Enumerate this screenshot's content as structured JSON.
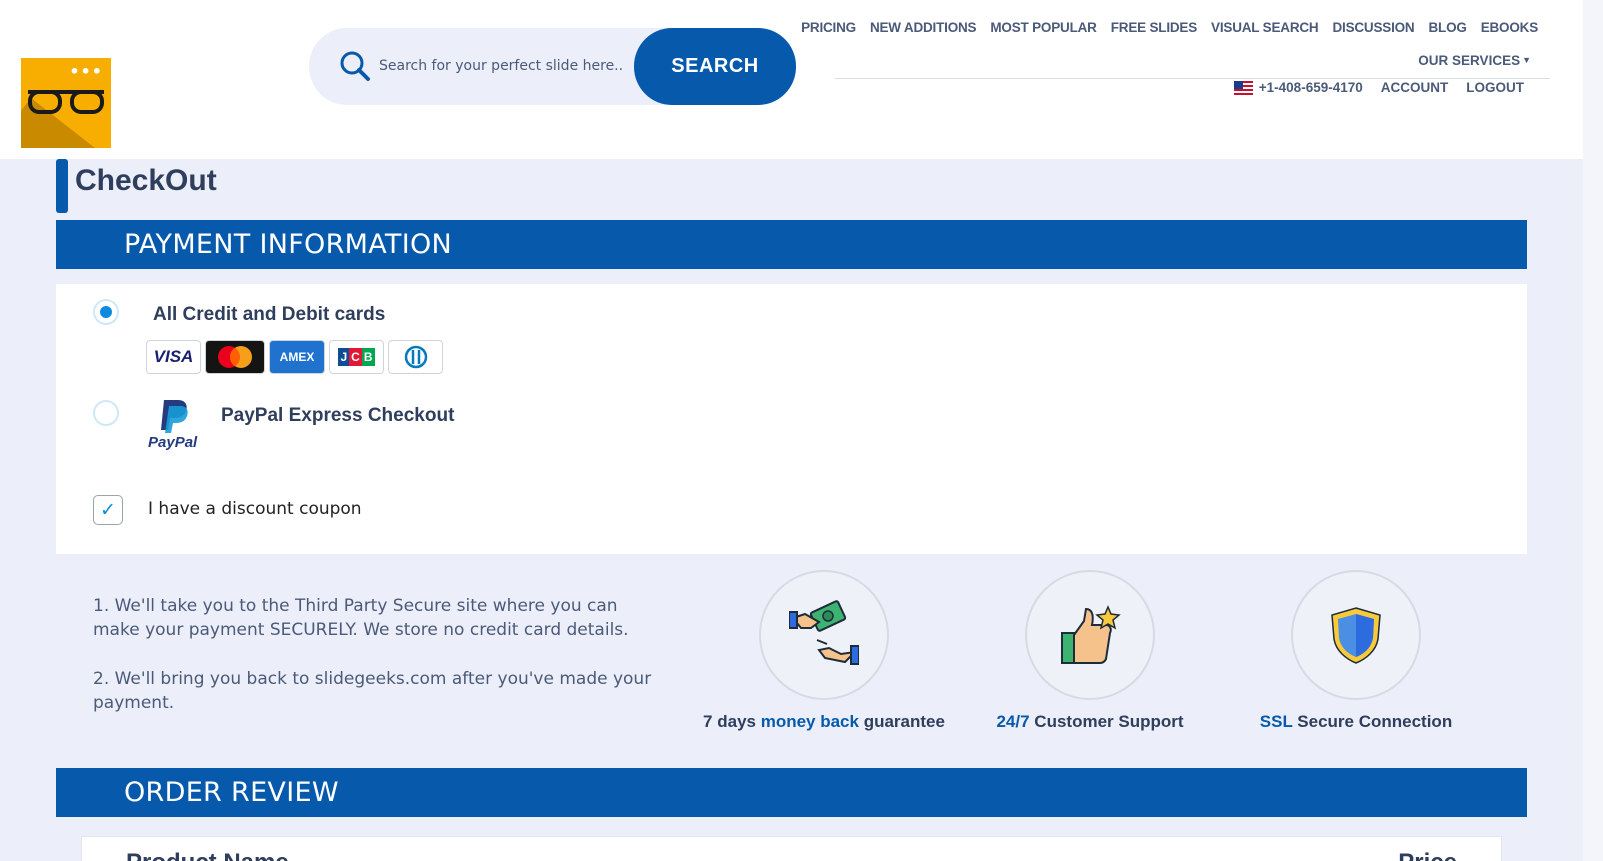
{
  "header": {
    "search": {
      "placeholder": "Search for your perfect slide here...",
      "button_label": "SEARCH"
    },
    "nav": {
      "items": [
        "PRICING",
        "NEW ADDITIONS",
        "MOST POPULAR",
        "FREE SLIDES",
        "VISUAL SEARCH",
        "DISCUSSION",
        "BLOG",
        "EBOOKS"
      ],
      "services_label": "OUR SERVICES"
    },
    "subnav": {
      "phone": "+1-408-659-4170",
      "account": "ACCOUNT",
      "logout": "LOGOUT"
    }
  },
  "page": {
    "title": "CheckOut"
  },
  "payment": {
    "section_title": "PAYMENT INFORMATION",
    "option_cards_label": "All Credit and Debit cards",
    "option_cards_selected": true,
    "cards": [
      "VISA",
      "AMEX",
      "JCB"
    ],
    "option_paypal_label": "PayPal Express Checkout",
    "paypal_logo_text": "PayPal",
    "option_paypal_selected": false,
    "coupon_label": "I have a discount coupon",
    "coupon_checked": true
  },
  "notes": {
    "note1": "1. We'll take you to the Third Party Secure site where you can make your payment SECURELY. We store no credit card details.",
    "note2": "2. We'll bring you back to slidegeeks.com after you've made your payment."
  },
  "features": [
    {
      "pre": "7 days ",
      "highlight": "money back",
      "post": " guarantee",
      "icon": "money-hand-icon"
    },
    {
      "pre": "",
      "highlight": "24/7",
      "post": " Customer Support",
      "icon": "thumbs-up-icon"
    },
    {
      "pre": "",
      "highlight": "SSL",
      "post": " Secure Connection",
      "icon": "shield-icon"
    }
  ],
  "order": {
    "section_title": "ORDER REVIEW",
    "col_product": "Product Name",
    "col_price": "Price"
  },
  "colors": {
    "brand_blue": "#0759ac",
    "accent_blue": "#0a8be0",
    "text_dark": "#2f3e5c",
    "page_bg": "#eceff9",
    "logo_yellow": "#f7ae00"
  }
}
